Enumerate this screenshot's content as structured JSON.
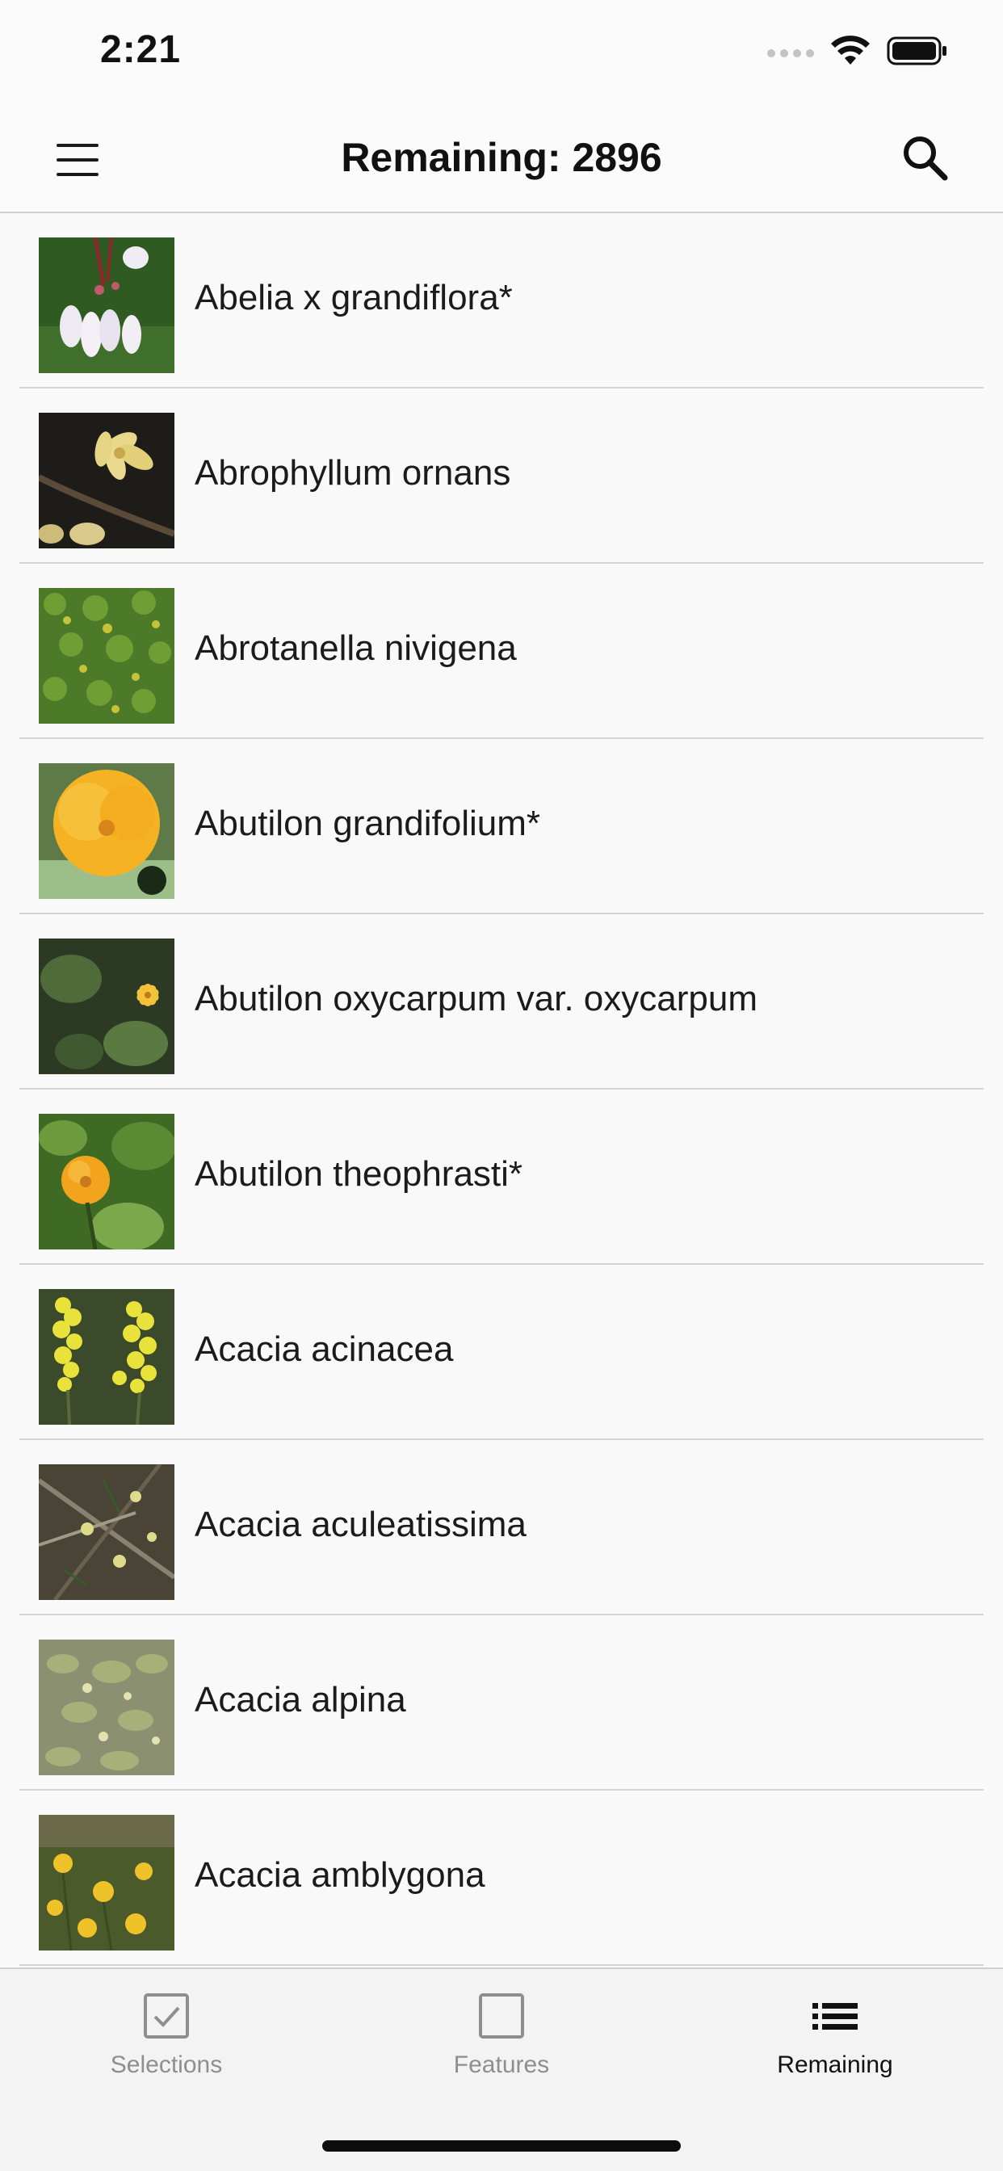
{
  "status_bar": {
    "time": "2:21"
  },
  "nav_bar": {
    "title": "Remaining: 2896",
    "menu_icon": "hamburger-menu-icon",
    "search_icon": "magnifier-icon"
  },
  "species": [
    {
      "name": "Abelia x grandiflora*",
      "thumb": "white-pink-tubular-flowers-photo"
    },
    {
      "name": "Abrophyllum ornans",
      "thumb": "pale-yellow-flower-on-branch-photo"
    },
    {
      "name": "Abrotanella nivigena",
      "thumb": "green-cushion-plant-photo"
    },
    {
      "name": "Abutilon grandifolium*",
      "thumb": "large-yellow-flower-photo"
    },
    {
      "name": "Abutilon oxycarpum var. oxycarpum",
      "thumb": "yellow-flower-green-leaves-photo"
    },
    {
      "name": "Abutilon theophrasti*",
      "thumb": "orange-yellow-flower-photo"
    },
    {
      "name": "Acacia acinacea",
      "thumb": "yellow-spike-flowers-photo"
    },
    {
      "name": "Acacia aculeatissima",
      "thumb": "spiny-shrub-yellow-balls-photo"
    },
    {
      "name": "Acacia alpina",
      "thumb": "grey-green-shrub-photo"
    },
    {
      "name": "Acacia amblygona",
      "thumb": "yellow-globe-flowers-photo"
    }
  ],
  "tab_bar": {
    "tabs": [
      {
        "label": "Selections",
        "icon": "checkbox-checked-icon",
        "active": false
      },
      {
        "label": "Features",
        "icon": "checkbox-empty-icon",
        "active": false
      },
      {
        "label": "Remaining",
        "icon": "list-icon",
        "active": true
      }
    ]
  },
  "colors": {
    "background": "#f9f9f9",
    "tab_active": "#111111",
    "tab_inactive": "#8e8e8e",
    "separator": "#d4d4d4"
  }
}
